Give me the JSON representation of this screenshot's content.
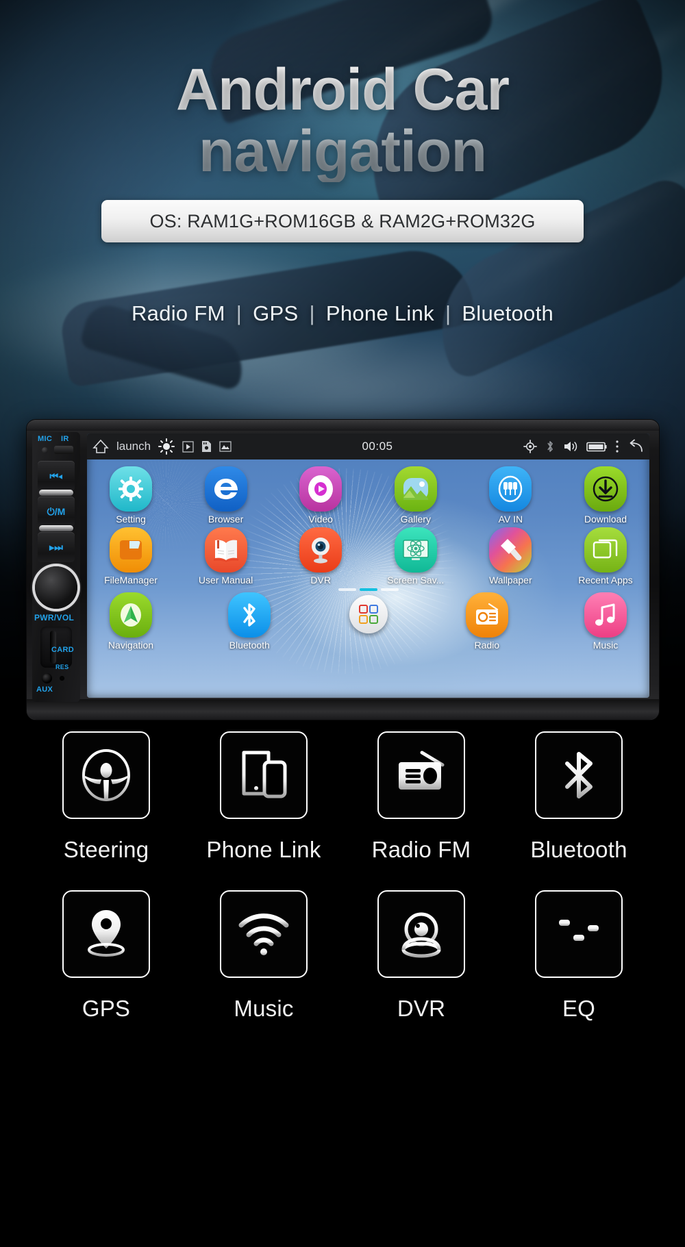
{
  "hero": {
    "headline_line1": "Android Car",
    "headline_line2": "navigation",
    "spec_banner": "OS: RAM1G+ROM16GB & RAM2G+ROM32G",
    "features": [
      "Radio FM",
      "GPS",
      "Phone Link",
      "Bluetooth"
    ],
    "separator": "|"
  },
  "device": {
    "controls": {
      "mic_label": "MIC",
      "ir_label": "IR",
      "prev_label": "⏮◂",
      "power_mode_label": "⏻/M",
      "next_label": "▸⏭",
      "knob_label": "PWR/VOL",
      "card_label": "CARD",
      "aux_label": "AUX",
      "reset_label": "RES"
    },
    "statusbar": {
      "home_icon": "home-icon",
      "launcher_label": "launch",
      "brightness_icon": "brightness-icon",
      "play_icon": "play-icon",
      "sdcard_icon": "sdcard-icon",
      "image_icon": "image-icon",
      "time": "00:05",
      "gps_icon": "gps-icon",
      "bluetooth_icon": "bluetooth-icon",
      "volume_icon": "volume-icon",
      "battery_icon": "battery-icon",
      "overflow_icon": "overflow-menu-icon",
      "back_icon": "back-icon"
    },
    "apps_row1": [
      {
        "label": "Setting",
        "icon": "gear-icon",
        "bg": "#35c9d6"
      },
      {
        "label": "Browser",
        "icon": "browser-icon",
        "bg": "#1b74d8"
      },
      {
        "label": "Video",
        "icon": "video-icon",
        "bg": "#cd48c6"
      },
      {
        "label": "Gallery",
        "icon": "gallery-icon",
        "bg": "#86c723"
      },
      {
        "label": "AV IN",
        "icon": "av-in-icon",
        "bg": "#24a5f0"
      },
      {
        "label": "Download",
        "icon": "download-icon",
        "bg": "#7fc616"
      }
    ],
    "apps_row2": [
      {
        "label": "FileManager",
        "icon": "folder-icon",
        "bg": "#f9a61a"
      },
      {
        "label": "User Manual",
        "icon": "book-icon",
        "bg": "#f4603a"
      },
      {
        "label": "DVR",
        "icon": "camera-icon",
        "bg": "#f4512c"
      },
      {
        "label": "Screen Sav...",
        "icon": "screensaver-icon",
        "bg": "#21ccac"
      },
      {
        "label": "Wallpaper",
        "icon": "brush-icon",
        "bg": "#e0529b"
      },
      {
        "label": "Recent Apps",
        "icon": "recent-apps-icon",
        "bg": "#8bc827"
      }
    ],
    "apps_row3": [
      {
        "label": "Navigation",
        "icon": "navigation-icon",
        "bg": "#7cc423"
      },
      {
        "label": "Bluetooth",
        "icon": "bluetooth-icon",
        "bg": "#18a8f5"
      },
      {
        "label": "Radio",
        "icon": "radio-icon",
        "bg": "#f79b24"
      },
      {
        "label": "Music",
        "icon": "music-icon",
        "bg": "#f0609a"
      }
    ],
    "app_drawer": {
      "icon": "app-drawer-icon",
      "label": ""
    },
    "page_dots": {
      "count": 3,
      "active_index": 1
    }
  },
  "feature_grid": [
    {
      "label": "Steering",
      "icon": "steering-wheel-icon"
    },
    {
      "label": "Phone Link",
      "icon": "phone-link-icon"
    },
    {
      "label": "Radio FM",
      "icon": "radio-fm-icon"
    },
    {
      "label": "Bluetooth",
      "icon": "bluetooth-icon"
    },
    {
      "label": "GPS",
      "icon": "gps-pin-icon"
    },
    {
      "label": "Music",
      "icon": "wifi-music-icon"
    },
    {
      "label": "DVR",
      "icon": "dvr-camera-icon"
    },
    {
      "label": "EQ",
      "icon": "equalizer-icon"
    }
  ],
  "colors": {
    "background": "#000000",
    "accent_blue": "#22a2ea",
    "banner_text": "#2d2f31",
    "screen_top": "#4f7fbe"
  }
}
